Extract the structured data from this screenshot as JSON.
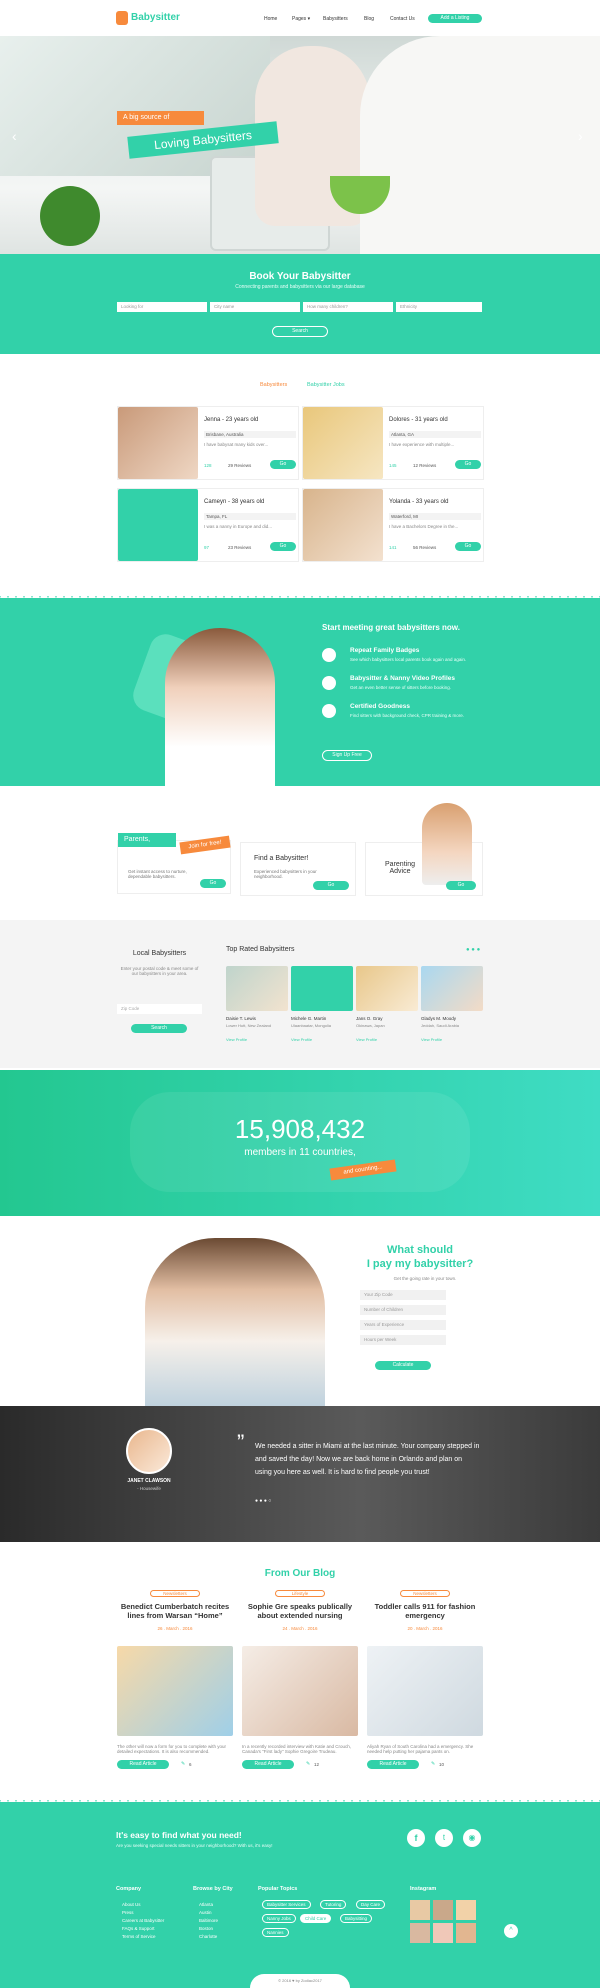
{
  "header": {
    "logo": "Babysitter",
    "nav": [
      "Home",
      "Pages ▾",
      "Babysitters",
      "Blog",
      "Contact Us"
    ],
    "cta": "Add a Listing"
  },
  "hero": {
    "tag": "A big source of",
    "title": "Loving Babysitters"
  },
  "book": {
    "title": "Book Your Babysitter",
    "subtitle": "Connecting parents and babysitters via our large database",
    "fields": [
      "Looking for",
      "City name",
      "How many children?",
      "Ethnicity"
    ],
    "button": "Search"
  },
  "tabs": {
    "first": "Babysitters",
    "second": "Babysitter Jobs"
  },
  "sitters": [
    {
      "name": "Jenna - 23 years old",
      "location": "Brisbane, Australia",
      "desc": "I have babysat many kids over...",
      "likes": "128",
      "reviews": "29 Reviews",
      "go": "Go"
    },
    {
      "name": "Dolores - 31 years old",
      "location": "Atlanta, GA",
      "desc": "I have experience with multiple...",
      "likes": "145",
      "reviews": "12 Reviews",
      "go": "Go"
    },
    {
      "name": "Cameyn - 38 years old",
      "location": "Tampa, FL",
      "desc": "I was a nanny in Europe and did...",
      "likes": "97",
      "reviews": "23 Reviews",
      "go": "Go"
    },
    {
      "name": "Yolanda - 33 years old",
      "location": "Waterford, MI",
      "desc": "I have a Bachelors Degree in the...",
      "likes": "141",
      "reviews": "56 Reviews",
      "go": "Go"
    }
  ],
  "meet": {
    "title": "Start meeting great babysitters now.",
    "features": [
      {
        "title": "Repeat Family Badges",
        "text": "See which babysitters local parents book again and again."
      },
      {
        "title": "Babysitter & Nanny Video Profiles",
        "text": "Get an even better sense of sitters before booking."
      },
      {
        "title": "Certified Goodness",
        "text": "Find sitters with background check, CPR training & more."
      }
    ],
    "button": "Sign Up Free"
  },
  "promo": {
    "parents": "Parents,",
    "join": "Join for free!",
    "parents_text": "Get instant access to nurture, dependable babysitters.",
    "find": "Find a Babysitter!",
    "find_text": "Experienced babysitters in your neighborhood.",
    "advice": "Parenting Advice",
    "go": "Go"
  },
  "local": {
    "title": "Local Babysitters",
    "text": "Enter your postal code & meet some of our babysitters in your area.",
    "placeholder": "Zip Code",
    "button": "Search"
  },
  "top": {
    "title": "Top Rated Babysitters",
    "people": [
      {
        "name": "Daisie T. Lewis",
        "loc": "Lower Hutt, New Zealand",
        "link": "View Profile"
      },
      {
        "name": "Michele G. Martin",
        "loc": "Ulaanbaatar, Mongolia",
        "link": "View Profile"
      },
      {
        "name": "Jans O. Gray",
        "loc": "Okinawa, Japan",
        "link": "View Profile"
      },
      {
        "name": "Gladys M. Moody",
        "loc": "Jeddah, Saudi Arabia",
        "link": "View Profile"
      }
    ]
  },
  "stats": {
    "number": "15,908,432",
    "text": "members in 11 countries,",
    "badge": "and counting..."
  },
  "pay": {
    "title1": "What should",
    "title2": "I pay my babysitter?",
    "subtitle": "Get the going rate in your town.",
    "fields": [
      "Your Zip Code",
      "Number of Children",
      "Years of Experience",
      "Hours per Week"
    ],
    "button": "Calculate"
  },
  "testimonial": {
    "quote": "We needed a sitter in Miami at the last minute. Your company stepped in and saved the day! Now we are back home in Orlando and plan on using you here as well. It is hard to find people you trust!",
    "name": "JANET CLAWSON",
    "role": "- Housewife"
  },
  "blog": {
    "title": "From Our Blog",
    "posts": [
      {
        "cat": "Newsletters",
        "title": "Benedict Cumberbatch recites lines from Warsan “Home”",
        "date": "26 . March . 2016",
        "excerpt": "The other will now a form for you to complete with your detailed expectations. It is also recommended.",
        "button": "Read Article",
        "count": "6"
      },
      {
        "cat": "Lifestyle",
        "title": "Sophie Gre speaks publically about extended nursing",
        "date": "24 . March . 2016",
        "excerpt": "In a recently recorded interview with Katie and Crouch, Canada's \"First lady\" Sophie Gregoire Trudeau.",
        "button": "Read Article",
        "count": "12"
      },
      {
        "cat": "Newsletters",
        "title": "Toddler calls 911 for fashion emergency",
        "date": "20 . March . 2016",
        "excerpt": "Aliyah Ryan of South Carolina had a emergency. She needed help putting her pajama pants on.",
        "button": "Read Article",
        "count": "10"
      }
    ]
  },
  "footer": {
    "headline": "It's easy to find what you need!",
    "sub": "Are you seeking special needs sitters in your neighborhood? With us, it's easy!",
    "company_title": "Company",
    "company": [
      "About Us",
      "Press",
      "Careers at Babysitter",
      "FAQs & Support",
      "Terms of Service"
    ],
    "city_title": "Browse by City",
    "cities": [
      "Atlanta",
      "Austin",
      "Baltimore",
      "Boston",
      "Charlotte"
    ],
    "topics_title": "Popular Topics",
    "topics": [
      "Babysitter Services",
      "Tutoring",
      "Day Care",
      "Nanny Jobs",
      "Child Care",
      "Babysitting",
      "Nannies"
    ],
    "insta_title": "Instagram",
    "copyright": "© 2016 ♥ by Zodiac2017"
  },
  "colors": {
    "accent": "#32d1a9",
    "orange": "#f78a3c"
  }
}
